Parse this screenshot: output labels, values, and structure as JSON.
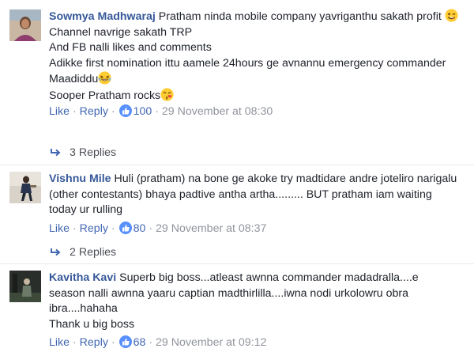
{
  "comments": [
    {
      "author": "Sowmya Madhwaraj",
      "lines": [
        "Pratham ninda mobile company yavriganthu sakath profit",
        "Channel navrige sakath TRP",
        "And FB nalli likes and comments",
        "Adikke first nomination ittu aamele 24hours ge avnannu emergency commander",
        "Maadiddu",
        "Sooper Pratham rocks"
      ],
      "like_label": "Like",
      "reply_label": "Reply",
      "like_count": "100",
      "timestamp": "29 November at 08:30",
      "replies_label": "3 Replies",
      "avatar_icon": "person-photo-icon"
    },
    {
      "author": "Vishnu Mile",
      "lines": [
        "Huli (pratham) na bone ge akoke try madtidare andre joteliro narigalu",
        "(other contestants) bhaya padtive antha artha......... BUT pratham iam waiting",
        "today ur rulling"
      ],
      "like_label": "Like",
      "reply_label": "Reply",
      "like_count": "80",
      "timestamp": "29 November at 08:37",
      "replies_label": "2 Replies",
      "avatar_icon": "person-photo-icon"
    },
    {
      "author": "Kavitha Kavi",
      "lines": [
        "Superb big boss...atleast awnna commander madadralla....e",
        "season nalli awnna yaaru captian madthirlilla....iwna nodi urkolowru obra",
        "ibra....hahaha",
        "Thank u big boss"
      ],
      "like_label": "Like",
      "reply_label": "Reply",
      "like_count": "68",
      "timestamp": "29 November at 09:12",
      "avatar_icon": "person-photo-icon"
    }
  ],
  "colors": {
    "author": "#365899",
    "link": "#4267b2",
    "like_badge": "#5890ff",
    "meta": "#90949c"
  }
}
